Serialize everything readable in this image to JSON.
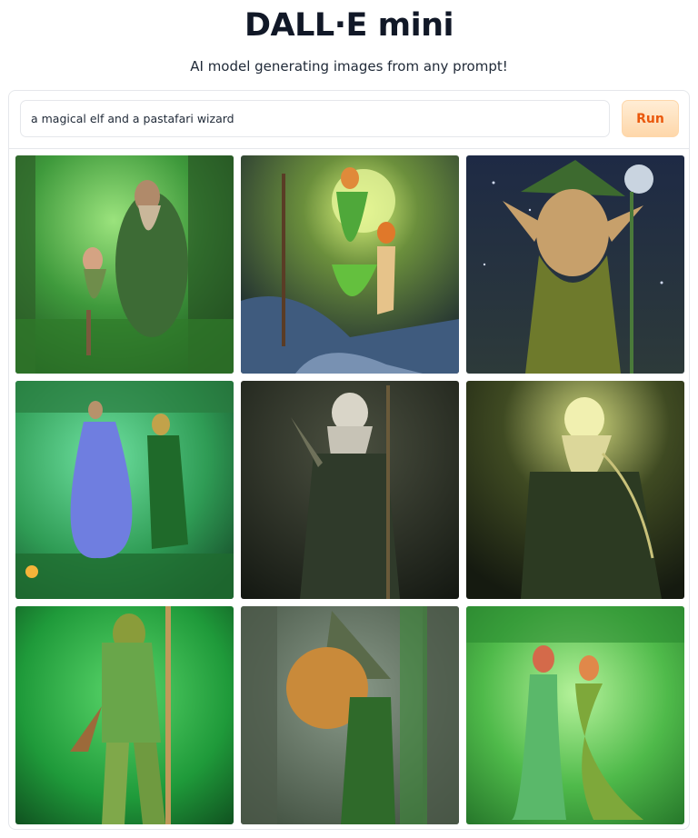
{
  "app": {
    "title": "DALL·E mini",
    "subtitle": "AI model generating images from any prompt!"
  },
  "prompt": {
    "value": "a magical elf and a pastafari wizard",
    "placeholder": ""
  },
  "run_button": {
    "label": "Run"
  },
  "colors": {
    "accent": "#ea580c",
    "button_bg": "#fed7aa",
    "border": "#e5e7eb",
    "title": "#111827"
  },
  "gallery": {
    "images": [
      {
        "name": "generated-image-1",
        "subject": "green forest, old bearded wizard with small elf"
      },
      {
        "name": "generated-image-2",
        "subject": "elf in green dress by moonlit stream with orange-haired figure"
      },
      {
        "name": "generated-image-3",
        "subject": "elf face portrait against starry night sky with glowing staff"
      },
      {
        "name": "generated-image-4",
        "subject": "blue-gowned figure and green elf in emerald forest"
      },
      {
        "name": "generated-image-5",
        "subject": "white-bearded wizard with staff on dark background"
      },
      {
        "name": "generated-image-6",
        "subject": "glowing wizard in dark green robe"
      },
      {
        "name": "generated-image-7",
        "subject": "green elf with long wooden staff"
      },
      {
        "name": "generated-image-8",
        "subject": "wizard with large orange beard in grey forest"
      },
      {
        "name": "generated-image-9",
        "subject": "two elves in green gowns in bright forest"
      }
    ]
  }
}
